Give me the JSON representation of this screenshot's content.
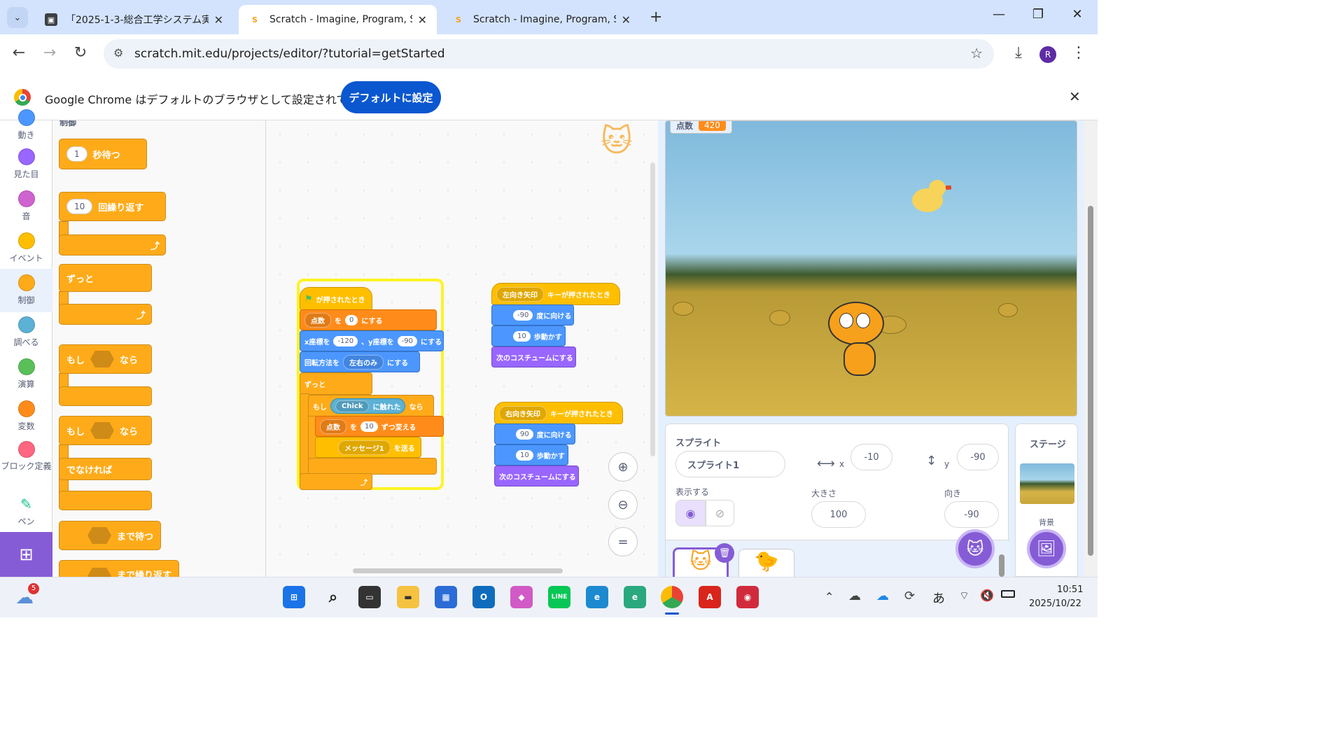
{
  "browser": {
    "tabs": [
      {
        "title": "「2025-1-3-総合工学システム実験",
        "active": false
      },
      {
        "title": "Scratch - Imagine, Program, Sha",
        "active": true
      },
      {
        "title": "Scratch - Imagine, Program, Sha",
        "active": false
      }
    ],
    "url": "scratch.mit.edu/projects/editor/?tutorial=getStarted",
    "profile_initial": "R",
    "infobar_text": "Google Chrome はデフォルトのブラウザとして設定されていません",
    "infobar_button": "デフォルトに設定"
  },
  "categories": [
    {
      "label": "動き",
      "color": "#4c97ff"
    },
    {
      "label": "見た目",
      "color": "#9966ff"
    },
    {
      "label": "音",
      "color": "#cf63cf"
    },
    {
      "label": "イベント",
      "color": "#ffbf00"
    },
    {
      "label": "制御",
      "color": "#ffab19"
    },
    {
      "label": "調べる",
      "color": "#5cb1d6"
    },
    {
      "label": "演算",
      "color": "#59c059"
    },
    {
      "label": "変数",
      "color": "#ff8c1a"
    },
    {
      "label": "ブロック定義",
      "color": "#ff6680"
    },
    {
      "label": "ペン",
      "color": "#0fbd8c"
    }
  ],
  "palette": {
    "heading": "制御",
    "wait_value": "1",
    "wait_label": "秒待つ",
    "repeat_value": "10",
    "repeat_label": "回繰り返す",
    "forever_label": "ずっと",
    "if_label": "もし",
    "then_label": "なら",
    "else_label": "でなければ",
    "wait_until_label": "まで待つ",
    "repeat_until_label": "まで繰り返す"
  },
  "script_main": {
    "hat": "が押されたとき",
    "set_var": "点数",
    "set_to": "を",
    "set_value": "0",
    "set_end": "にする",
    "goto_x_label": "x座標を",
    "goto_x": "-120",
    "goto_sep": "、y座標を",
    "goto_y": "-90",
    "goto_end": "にする",
    "rot_label": "回転方法を",
    "rot_value": "左右のみ",
    "rot_end": "にする",
    "forever": "ずっと",
    "if": "もし",
    "touching_obj": "Chick",
    "touching_label": "に触れた",
    "then": "なら",
    "change_var": "点数",
    "change_by": "を",
    "change_value": "10",
    "change_end": "ずつ変える",
    "msg": "メッセージ1",
    "msg_end": "を送る"
  },
  "script_left": {
    "key": "左向き矢印",
    "hat_end": "キーが押されたとき",
    "dir": "-90",
    "dir_label": "度に向ける",
    "steps": "10",
    "steps_label": "歩動かす",
    "costume": "次のコスチュームにする"
  },
  "script_right": {
    "key": "右向き矢印",
    "hat_end": "キーが押されたとき",
    "dir": "90",
    "dir_label": "度に向ける",
    "steps": "10",
    "steps_label": "歩動かす",
    "costume": "次のコスチュームにする"
  },
  "stage": {
    "monitor_label": "点数",
    "monitor_value": "420"
  },
  "sprite_info": {
    "sprite_label": "スプライト",
    "name": "スプライト1",
    "x_label": "x",
    "x": "-10",
    "y_label": "y",
    "y": "-90",
    "show_label": "表示する",
    "size_label": "大きさ",
    "size": "100",
    "direction_label": "向き",
    "direction": "-90"
  },
  "stage_panel": {
    "title": "ステージ",
    "backdrop_label": "背景"
  },
  "taskbar": {
    "notif_count": "5",
    "time": "10:51",
    "date": "2025/10/22",
    "ime": "あ"
  }
}
